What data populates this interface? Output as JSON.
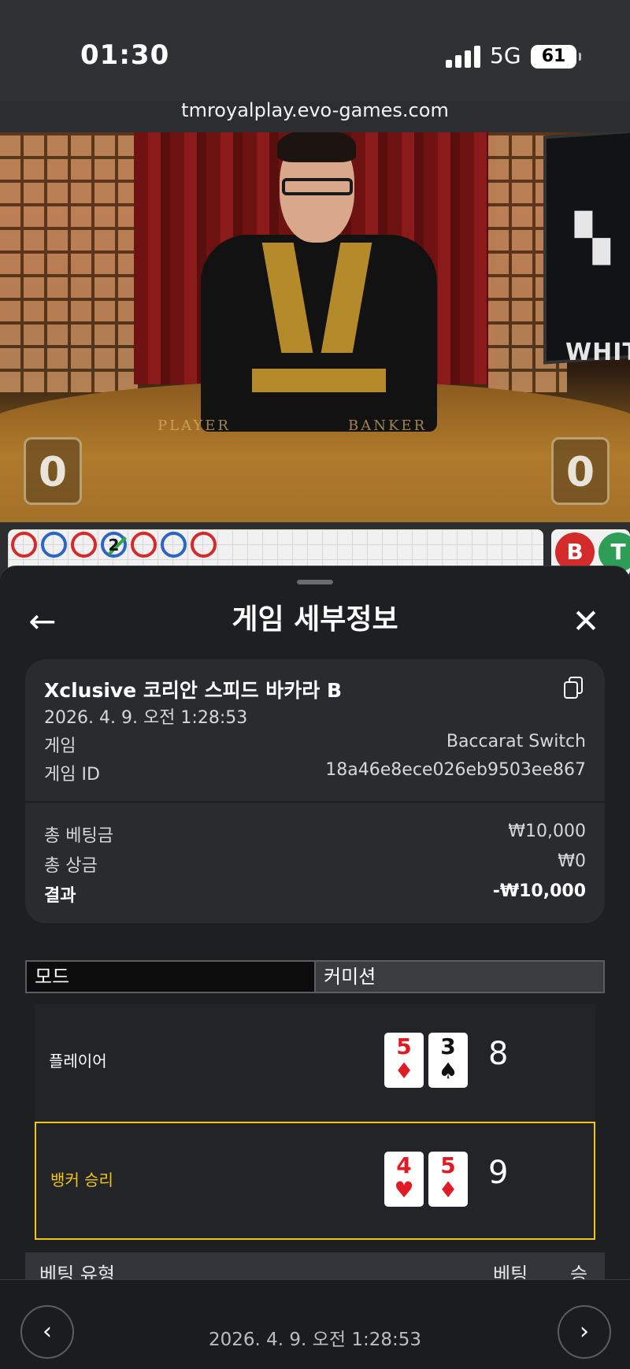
{
  "status_bar": {
    "time": "01:30",
    "network": "5G",
    "battery": "61"
  },
  "browser": {
    "url": "tmroyalplay.evo-games.com"
  },
  "video": {
    "table_left_label": "PLAYER",
    "table_right_label": "BANKER",
    "player_score": "0",
    "banker_score": "0",
    "monitor_logo": "WHITE"
  },
  "roadmap": {
    "beads": [
      "red",
      "blue",
      "red",
      "blue",
      "red",
      "blue",
      "red"
    ],
    "tie_marker": "2",
    "banker_pill": "B",
    "tie_pill": "T"
  },
  "sheet": {
    "title": "게임 세부정보",
    "back_icon": "arrow-left-icon",
    "close_icon": "close-icon",
    "game_name": "Xclusive 코리안 스피드 바카라 B",
    "datetime": "2026. 4. 9. 오전 1:28:53",
    "game_label": "게임",
    "game_value": "Baccarat Switch",
    "game_id_label": "게임 ID",
    "game_id_value": "18a46e8ece026eb9503ee867",
    "total_bet_label": "총 베팅금",
    "total_bet_value": "₩10,000",
    "total_win_label": "총 상금",
    "total_win_value": "₩0",
    "result_label": "결과",
    "result_value": "-₩10,000"
  },
  "tabs": {
    "mode": "모드",
    "commission": "커미션"
  },
  "hands": {
    "player": {
      "label": "플레이어",
      "cards": [
        {
          "rank": "5",
          "suit": "♦"
        },
        {
          "rank": "3",
          "suit": "♠"
        }
      ],
      "total": "8"
    },
    "banker": {
      "label": "뱅커 승리",
      "cards": [
        {
          "rank": "4",
          "suit": "♥"
        },
        {
          "rank": "5",
          "suit": "♦"
        }
      ],
      "total": "9"
    }
  },
  "bet_table": {
    "col_type": "베팅 유형",
    "col_bet": "베팅",
    "col_win": "승"
  },
  "footer": {
    "datetime": "2026. 4. 9. 오전 1:28:53"
  },
  "colors": {
    "win_highlight": "#f0c419",
    "card_red": "#e01b24"
  }
}
